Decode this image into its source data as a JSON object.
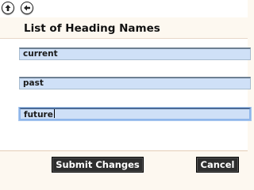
{
  "toolbar": {
    "up_icon": "arrow-up-icon",
    "back_icon": "arrow-left-icon"
  },
  "header": {
    "title": "List of Heading Names"
  },
  "fields": [
    {
      "value": "current"
    },
    {
      "value": "past"
    },
    {
      "value": "future"
    }
  ],
  "buttons": {
    "submit_label": "Submit Changes",
    "cancel_label": "Cancel"
  },
  "colors": {
    "field_bg": "#cfe0f7",
    "button_bg": "#2e2e2e",
    "page_bg": "#fdf8f0"
  }
}
